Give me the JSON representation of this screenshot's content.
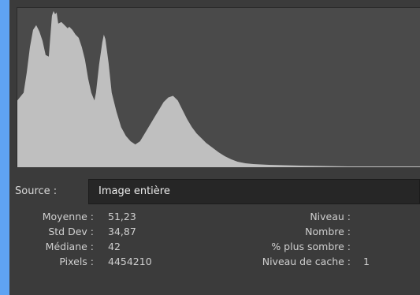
{
  "source": {
    "label": "Source :",
    "selected": "Image entière"
  },
  "stats_left": [
    {
      "label": "Moyenne :",
      "value": "51,23"
    },
    {
      "label": "Std Dev :",
      "value": "34,87"
    },
    {
      "label": "Médiane :",
      "value": "42"
    },
    {
      "label": "Pixels :",
      "value": "4454210"
    }
  ],
  "stats_right": [
    {
      "label": "Niveau :",
      "value": ""
    },
    {
      "label": "Nombre :",
      "value": ""
    },
    {
      "label": "% plus sombre :",
      "value": ""
    },
    {
      "label": "Niveau de cache :",
      "value": "1"
    }
  ],
  "colors": {
    "panel": "#3b3b3b",
    "histogram_bg": "#4a4a4a",
    "histogram_fill": "#bfbfbf",
    "frame": "#5fa3f3"
  }
}
